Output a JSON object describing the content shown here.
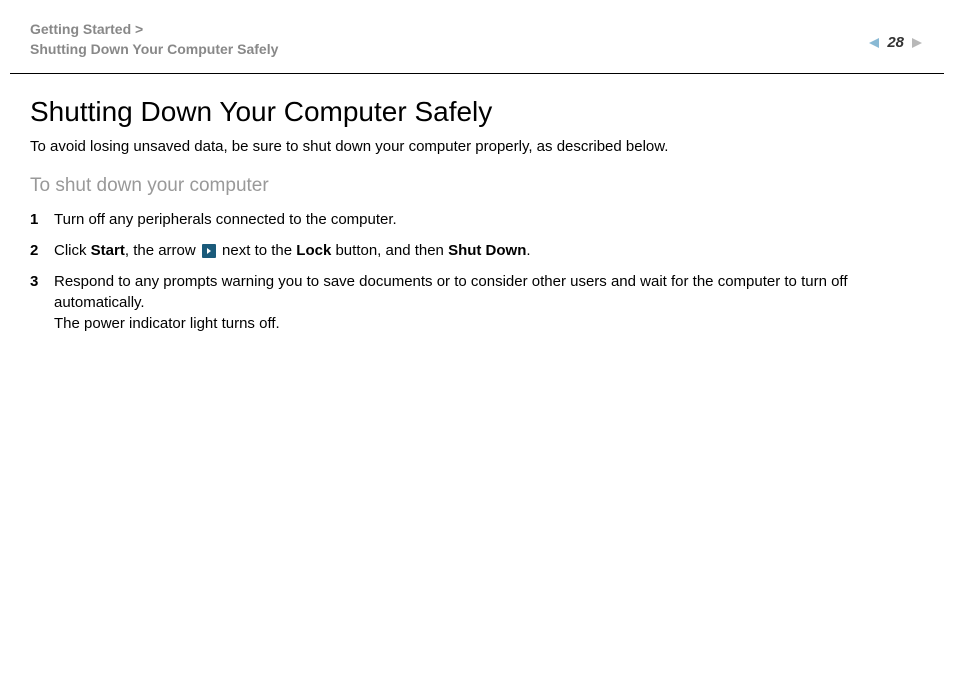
{
  "header": {
    "breadcrumb_line1": "Getting Started >",
    "breadcrumb_line2": "Shutting Down Your Computer Safely",
    "page_number": "28"
  },
  "content": {
    "title": "Shutting Down Your Computer Safely",
    "intro": "To avoid losing unsaved data, be sure to shut down your computer properly, as described below.",
    "subheading": "To shut down your computer",
    "steps": [
      {
        "num": "1",
        "text": "Turn off any peripherals connected to the computer."
      },
      {
        "num": "2",
        "pre": "Click ",
        "b1": "Start",
        "mid1": ", the arrow ",
        "mid2": " next to the ",
        "b2": "Lock",
        "mid3": " button, and then ",
        "b3": "Shut Down",
        "post": "."
      },
      {
        "num": "3",
        "line1": "Respond to any prompts warning you to save documents or to consider other users and wait for the computer to turn off automatically.",
        "line2": "The power indicator light turns off."
      }
    ]
  }
}
